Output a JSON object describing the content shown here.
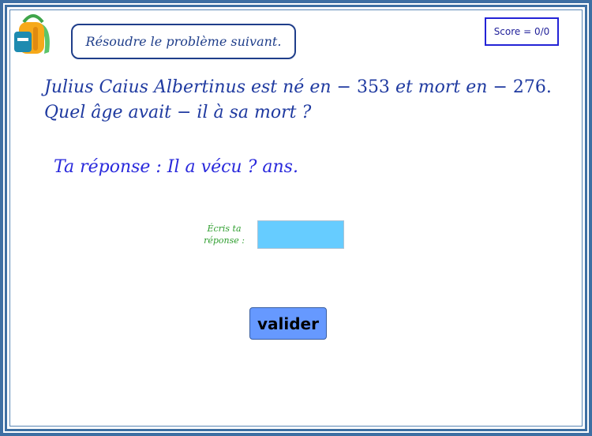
{
  "header": {
    "instruction": "Résoudre le problème suivant.",
    "score": "Score = 0/0"
  },
  "problem": {
    "line1_a": "Julius Caius Albertinus est né en",
    "line1_year_birth": "− 353",
    "line1_b": "et mort en",
    "line1_year_death": "− 276.",
    "line2": "Quel âge avait − il à sa mort ?"
  },
  "answer_template": "Ta réponse : Il a vécu ? ans.",
  "input": {
    "label_line1": "Écris ta",
    "label_line2": "réponse :",
    "value": ""
  },
  "submit_label": "valider",
  "colors": {
    "frame": "#3e6fa3",
    "instruction_text": "#1f3e8a",
    "problem_text": "#1f3aa0",
    "answer_text": "#2a2adc",
    "prompt_text": "#2e9e2e",
    "input_bg": "#66ccff",
    "button_bg": "#6699ff"
  },
  "icons": {
    "app_logo": "backpack-icon"
  }
}
